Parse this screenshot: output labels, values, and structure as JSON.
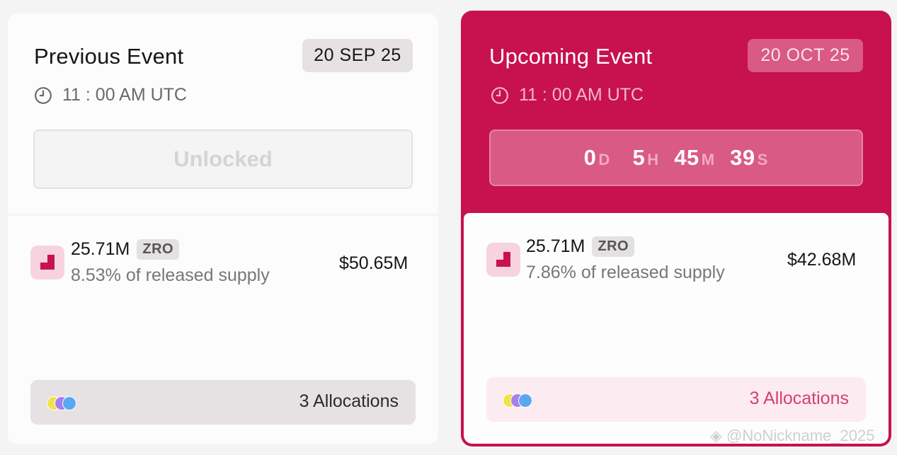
{
  "previous": {
    "title": "Previous Event",
    "date": "20 SEP 25",
    "time": "11 : 00 AM UTC",
    "status": "Unlocked",
    "token": {
      "amount": "25.71M",
      "symbol": "ZRO",
      "supply": "8.53% of released supply",
      "usd": "$50.65M"
    },
    "allocations": "3 Allocations"
  },
  "upcoming": {
    "title": "Upcoming Event",
    "date": "20 OCT 25",
    "time": "11 : 00 AM UTC",
    "countdown": {
      "days": "0",
      "days_unit": "D",
      "hours": "5",
      "hours_unit": "H",
      "minutes": "45",
      "minutes_unit": "M",
      "seconds": "39",
      "seconds_unit": "S"
    },
    "token": {
      "amount": "25.71M",
      "symbol": "ZRO",
      "supply": "7.86% of released supply",
      "usd": "$42.68M"
    },
    "allocations": "3 Allocations"
  },
  "watermark": "@NoNickname_2025",
  "colors": {
    "accent": "#c8114f",
    "dot1": "#f2e24a",
    "dot2": "#a77ef0",
    "dot3": "#5aa8f2"
  }
}
